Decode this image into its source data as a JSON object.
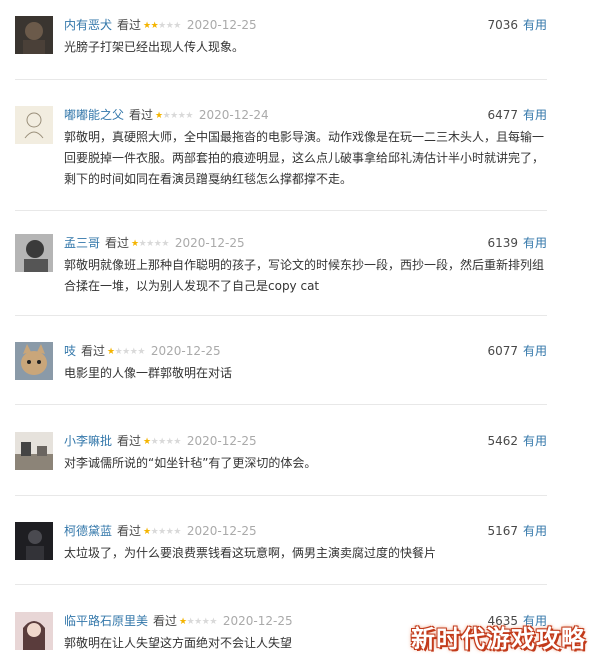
{
  "reviews": [
    {
      "user": "内有恶犬",
      "action": "看过",
      "stars_on": "★★",
      "stars_off": "★★★",
      "rating": 2,
      "date": "2020-12-25",
      "votes": "7036",
      "useful": "有用",
      "text": "光膀子打架已经出现人传人现象。",
      "avatar_bg": "#3a3530"
    },
    {
      "user": "嘟嘟能之父",
      "action": "看过",
      "stars_on": "★",
      "stars_off": "★★★★",
      "rating": 1,
      "date": "2020-12-24",
      "votes": "6477",
      "useful": "有用",
      "text": "郭敬明，真硬照大师，全中国最拖沓的电影导演。动作戏像是在玩一二三木头人，且每输一回要脱掉一件衣服。两部套拍的痕迹明显，这么点儿破事拿给邱礼涛估计半小时就讲完了，剩下的时间如同在看演员蹭戛纳红毯怎么撑都撑不走。",
      "avatar_bg": "#f2ede0"
    },
    {
      "user": "孟三哥",
      "action": "看过",
      "stars_on": "★",
      "stars_off": "★★★★",
      "rating": 1,
      "date": "2020-12-25",
      "votes": "6139",
      "useful": "有用",
      "text": "郭敬明就像班上那种自作聪明的孩子，写论文的时候东抄一段，西抄一段，然后重新排列组合揉在一堆，以为别人发现不了自己是copy cat",
      "avatar_bg": "#8a8a8a"
    },
    {
      "user": "吱",
      "action": "看过",
      "stars_on": "★",
      "stars_off": "★★★★",
      "rating": 1,
      "date": "2020-12-25",
      "votes": "6077",
      "useful": "有用",
      "text": "电影里的人像一群郭敬明在对话",
      "avatar_bg": "#c9a67a"
    },
    {
      "user": "小李嘛批",
      "action": "看过",
      "stars_on": "★",
      "stars_off": "★★★★",
      "rating": 1,
      "date": "2020-12-25",
      "votes": "5462",
      "useful": "有用",
      "text": "对李诚儒所说的“如坐针毡”有了更深切的体会。",
      "avatar_bg": "#b8b0a4"
    },
    {
      "user": "柯德黛蓝",
      "action": "看过",
      "stars_on": "★",
      "stars_off": "★★★★",
      "rating": 1,
      "date": "2020-12-25",
      "votes": "5167",
      "useful": "有用",
      "text": "太垃圾了，为什么要浪费票钱看这玩意啊，俩男主演卖腐过度的快餐片",
      "avatar_bg": "#1e1e22"
    },
    {
      "user": "临平路石原里美",
      "action": "看过",
      "stars_on": "★",
      "stars_off": "★★★★",
      "rating": 1,
      "date": "2020-12-25",
      "votes": "4635",
      "useful": "有用",
      "text": "郭敬明在让人失望这方面绝对不会让人失望",
      "avatar_bg": "#e8d6d6"
    }
  ],
  "watermark": "新时代游戏攻略"
}
